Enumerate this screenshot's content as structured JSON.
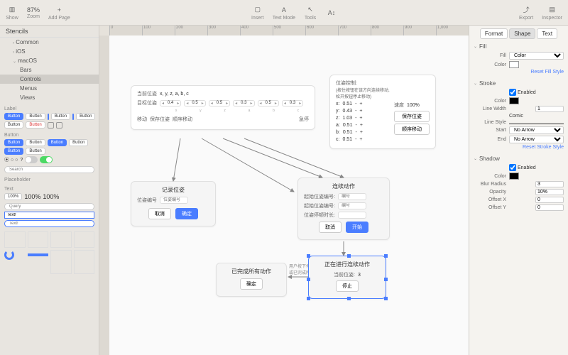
{
  "toolbar": {
    "show": "Show",
    "zoom_value": "87%",
    "zoom": "Zoom",
    "add_page": "Add Page",
    "insert": "Insert",
    "text_mode": "Text Mode",
    "tools": "Tools",
    "export": "Export",
    "inspector": "Inspector"
  },
  "stencils": {
    "header": "Stencils",
    "items": [
      "Common",
      "iOS",
      "macOS"
    ],
    "macos_children": [
      "Bars",
      "Controls",
      "Menus",
      "Views"
    ],
    "selected": "Controls"
  },
  "palette": {
    "label": "Label",
    "button": "Button",
    "placeholder": "Placeholder",
    "text": "Text",
    "search_ph": "Search",
    "query_ph": "Query",
    "text_val": "Text!",
    "pct": "100%"
  },
  "canvas": {
    "ruler": [
      "0",
      "100",
      "200",
      "300",
      "400",
      "500",
      "600",
      "700",
      "800",
      "900",
      "1,000"
    ],
    "pose_panel": {
      "cur_pose_lbl": "当前位姿",
      "cur_pose_val": "x, y, z, a, b, c",
      "target_pose_lbl": "目标位姿",
      "axes": [
        "x",
        "y",
        "z",
        "a",
        "b",
        "c"
      ],
      "vals": [
        "0.4",
        "0.5",
        "0.5",
        "0.3",
        "0.5",
        "0.3"
      ],
      "move": "移动",
      "save": "保存位姿",
      "seq": "顺序移动",
      "estop": "急停"
    },
    "control_panel": {
      "title": "位姿控制:",
      "hint1": "(按住按钮在该方向连续移动,",
      "hint2": "松开按钮停止移动)",
      "rows": [
        {
          "k": "x:",
          "v": "0.51"
        },
        {
          "k": "y:",
          "v": "0.43"
        },
        {
          "k": "z:",
          "v": "1.03"
        },
        {
          "k": "a:",
          "v": "0.51"
        },
        {
          "k": "b:",
          "v": "0.51"
        },
        {
          "k": "c:",
          "v": "0.51"
        }
      ],
      "speed_lbl": "速度",
      "speed_val": "100%",
      "save": "保存位姿",
      "seq": "顺序移动"
    },
    "record": {
      "title": "记录位姿",
      "label": "位姿编号",
      "ph": "位姿编号",
      "cancel": "取消",
      "confirm": "确定"
    },
    "continuous": {
      "title": "连续动作",
      "start_lbl": "起始位姿编号:",
      "end_lbl": "起始位姿编号:",
      "dwell_lbl": "位姿停顿时长:",
      "ph": "编号",
      "cancel": "取消",
      "start": "开始"
    },
    "done": {
      "title": "已完成所有动作",
      "note1": "用户按下停止按钮",
      "note2": "或已完成所有动作",
      "confirm": "确定"
    },
    "running": {
      "title": "正在进行连续动作",
      "cur_lbl": "当前位姿:",
      "cur_val": "3",
      "stop": "停止"
    }
  },
  "inspector": {
    "tabs": [
      "Format",
      "Shape",
      "Text"
    ],
    "fill": {
      "hdr": "Fill",
      "lbl": "Fill",
      "type": "Color",
      "color": "#ffffff",
      "reset": "Reset Fill Style"
    },
    "stroke": {
      "hdr": "Stroke",
      "enabled": "Enabled",
      "color": "#000000",
      "lw_lbl": "Line Width",
      "lw": "1",
      "comic": "Comic",
      "ls_lbl": "Line Style",
      "start_lbl": "Start",
      "start": "No Arrow",
      "end_lbl": "End",
      "end": "No Arrow",
      "reset": "Reset Stroke Style"
    },
    "shadow": {
      "hdr": "Shadow",
      "enabled": "Enabled",
      "color": "#000000",
      "blur_lbl": "Blur Radius",
      "blur": "3",
      "opacity_lbl": "Opacity",
      "opacity": "10%",
      "ox_lbl": "Offset X",
      "ox": "0",
      "oy_lbl": "Offset Y",
      "oy": "0"
    }
  },
  "chart_data": null
}
